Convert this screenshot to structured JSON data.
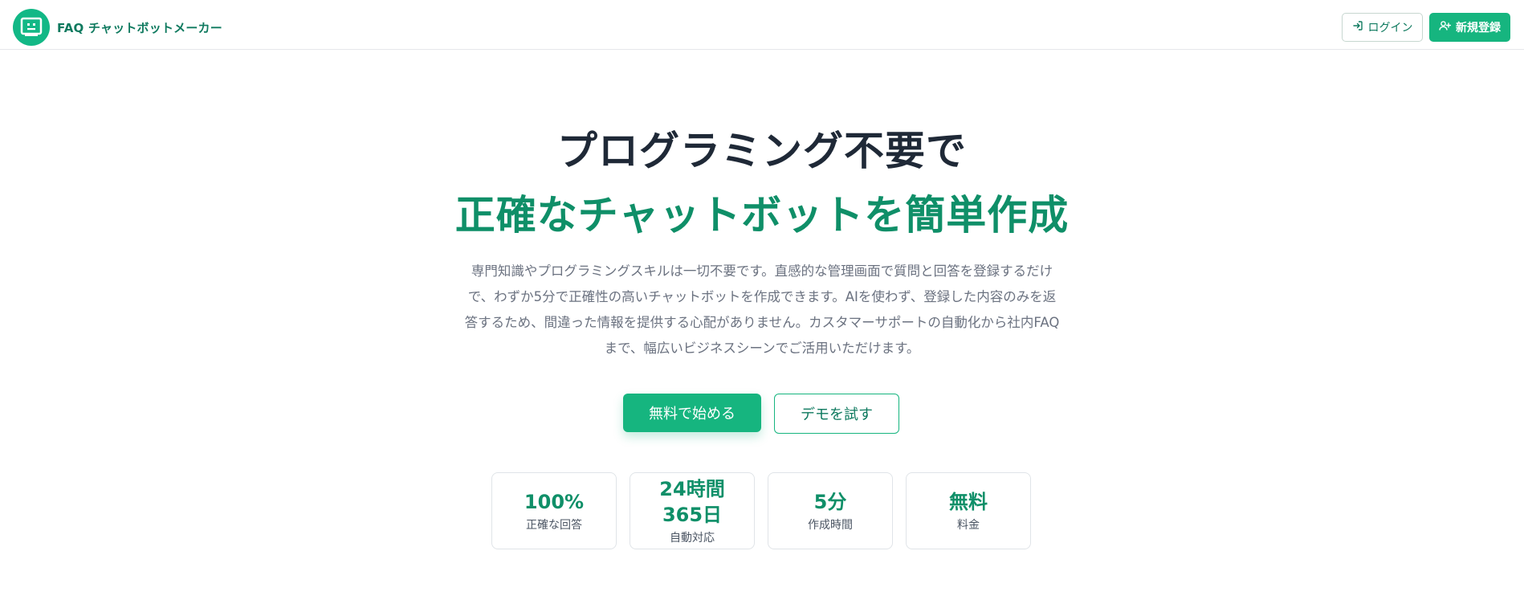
{
  "header": {
    "brand_name": "FAQ チャットボットメーカー",
    "login_label": "ログイン",
    "register_label": "新規登録"
  },
  "hero": {
    "title_line1": "プログラミング不要で",
    "title_line2": "正確なチャットボットを簡単作成",
    "description": "専門知識やプログラミングスキルは一切不要です。直感的な管理画面で質問と回答を登録するだけで、わずか5分で正確性の高いチャットボットを作成できます。AIを使わず、登録した内容のみを返答するため、間違った情報を提供する心配がありません。カスタマーサポートの自動化から社内FAQまで、幅広いビジネスシーンでご活用いただけます。",
    "cta_primary": "無料で始める",
    "cta_secondary": "デモを試す"
  },
  "stats": [
    {
      "value": "100%",
      "label": "正確な回答"
    },
    {
      "value": "24時間\n365日",
      "label": "自動対応"
    },
    {
      "value": "5分",
      "label": "作成時間"
    },
    {
      "value": "無料",
      "label": "料金"
    }
  ],
  "colors": {
    "accent": "#16b57f",
    "accent_dark": "#0f8f68",
    "text_dark": "#1f2937",
    "text_muted": "#6b7280"
  },
  "icons": {
    "logo": "robot-face-icon",
    "login": "login-arrow-icon",
    "register": "user-plus-icon"
  }
}
